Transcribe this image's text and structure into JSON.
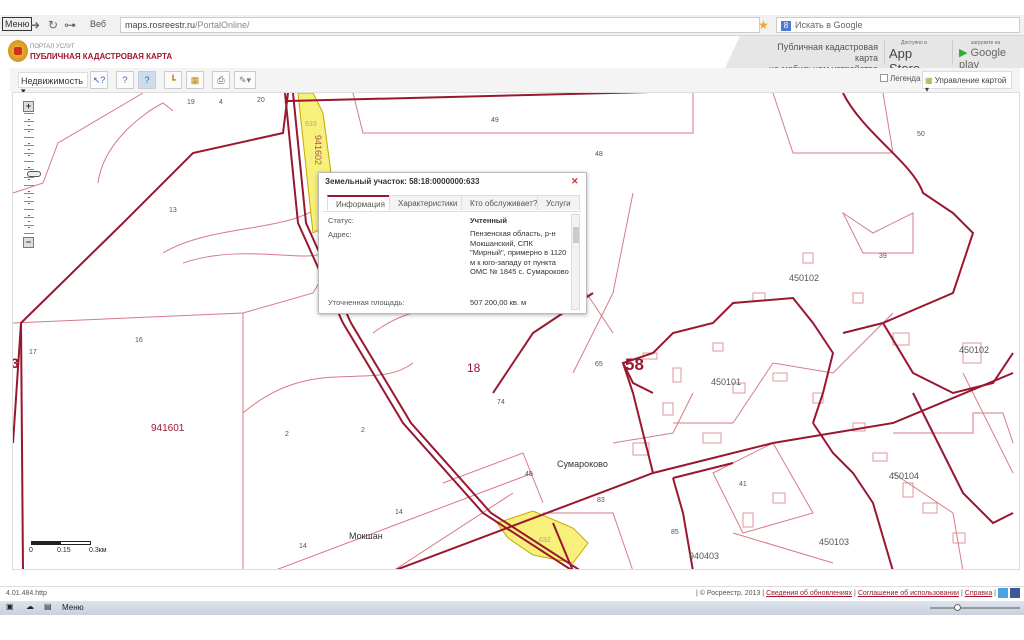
{
  "browser": {
    "menu_label": "Меню",
    "web_label": "Веб",
    "url_host": "maps.rosreestr.ru",
    "url_path": "/PortalOnline/",
    "search_placeholder": "Искать в Google"
  },
  "header": {
    "portal_label": "ПОРТАЛ УСЛУГ",
    "title": "ПУБЛИЧНАЯ КАДАСТРОВАЯ КАРТА",
    "mobile_line1": "Публичная кадастровая карта",
    "mobile_line2": "на мобильном устройстве",
    "appstore_small": "Доступно в",
    "appstore": "App Store",
    "gplay_small": "загрузите на",
    "gplay": "Google play"
  },
  "toolbar": {
    "layer_select": "Недвижимость",
    "legend_label": "Легенда",
    "map_control": "Управление картой"
  },
  "map": {
    "labels": [
      "19",
      "4",
      "20",
      "633",
      "941602",
      "49",
      "50",
      "48",
      "13",
      "39",
      "450102",
      "450102",
      "68",
      "16",
      "17",
      "18",
      "58",
      "65",
      "450101",
      "74",
      "941601",
      "2",
      "2",
      "45",
      "Сумароково",
      "83",
      "41",
      "450104",
      "14",
      "14",
      "Мокшан",
      "632",
      "85",
      "940403",
      "450103",
      "3"
    ],
    "scale": {
      "s0": "0",
      "s1": "0.15",
      "s2": "0.3км"
    },
    "colors": {
      "boundary": "#9a1730",
      "parcel_line": "#d77a88",
      "selected_fill": "#f7f07a"
    }
  },
  "popup": {
    "title": "Земельный участок: 58:18:0000000:633",
    "tabs": [
      "Информация",
      "Характеристики",
      "Кто обслуживает?",
      "Услуги"
    ],
    "rows": [
      {
        "key": "Статус:",
        "value": "Учтенный"
      },
      {
        "key": "Адрес:",
        "value": "Пензенская область, р-н Мокшанский, СПК \"Мирный\", примерно в 1120 м к юго-западу от пункта ОМС № 1845 с. Сумароково"
      },
      {
        "key": "Уточненная площадь:",
        "value": "507 200,00 кв. м"
      }
    ]
  },
  "footer": {
    "version": "4.01.484.http",
    "copyright": "| © Росреестр, 2013 |",
    "link1": "Сведения об обновлениях",
    "link2": "Соглашение об использовании",
    "link3": "Справка"
  },
  "statusbar": {
    "menu_label": "Меню"
  }
}
